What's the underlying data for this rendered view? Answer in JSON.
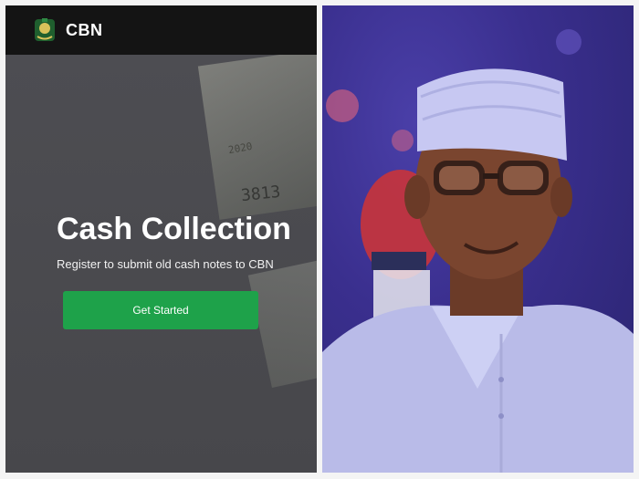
{
  "app": {
    "brand": "CBN",
    "logo_icon": "cbn-crest-icon"
  },
  "hero": {
    "title": "Cash Collection",
    "subtitle": "Register to submit old cash notes to CBN",
    "cta_label": "Get Started",
    "note_serial": "3813",
    "note_year": "2020"
  },
  "colors": {
    "topbar": "#141414",
    "hero_background": "#4b4b4f",
    "cta": "#1ea24a",
    "photo_background": "#3a2f8e",
    "cap_and_attire": "#c7c8f2"
  },
  "photo": {
    "subject": "portrait-photo",
    "accent_glow": "#f06a7a"
  }
}
